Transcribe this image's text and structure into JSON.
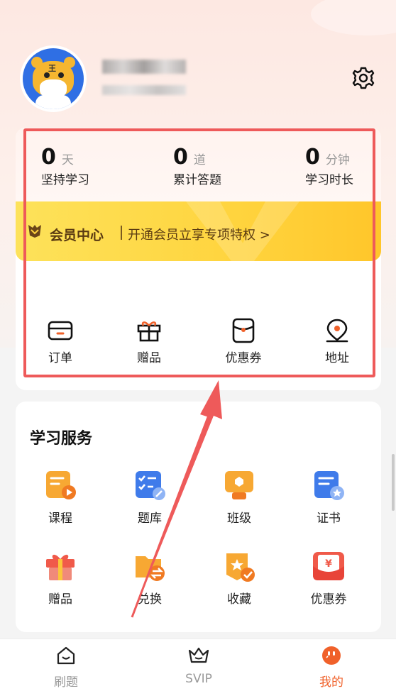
{
  "profile": {
    "avatar_icon": "tiger-avatar-icon",
    "avatar_mark": "王",
    "name_obscured": true,
    "settings_icon": "gear-icon"
  },
  "stats": [
    {
      "value": "0",
      "unit": "天",
      "label": "坚持学习"
    },
    {
      "value": "0",
      "unit": "道",
      "label": "累计答题"
    },
    {
      "value": "0",
      "unit": "分钟",
      "label": "学习时长"
    }
  ],
  "vip": {
    "title": "会员中心",
    "description": "开通会员立享专项特权 >"
  },
  "quick_actions": [
    {
      "label": "订单",
      "icon": "order-box-icon"
    },
    {
      "label": "赠品",
      "icon": "gift-icon"
    },
    {
      "label": "优惠券",
      "icon": "coupon-icon"
    },
    {
      "label": "地址",
      "icon": "location-pin-icon"
    }
  ],
  "services": {
    "title": "学习服务",
    "items": [
      {
        "label": "课程",
        "icon": "course-icon"
      },
      {
        "label": "题库",
        "icon": "question-bank-icon"
      },
      {
        "label": "班级",
        "icon": "class-icon"
      },
      {
        "label": "证书",
        "icon": "certificate-icon"
      },
      {
        "label": "赠品",
        "icon": "gift-icon"
      },
      {
        "label": "兑换",
        "icon": "exchange-icon"
      },
      {
        "label": "收藏",
        "icon": "favorite-icon"
      },
      {
        "label": "优惠券",
        "icon": "coupon-icon"
      }
    ]
  },
  "nav": [
    {
      "label": "刷题",
      "icon": "practice-icon",
      "active": false
    },
    {
      "label": "SVIP",
      "icon": "crown-icon",
      "active": false
    },
    {
      "label": "我的",
      "icon": "mine-icon",
      "active": true
    }
  ],
  "colors": {
    "accent": "#f0612a",
    "highlight": "#ee5a5a",
    "vip_gold": "#ffd43e"
  }
}
